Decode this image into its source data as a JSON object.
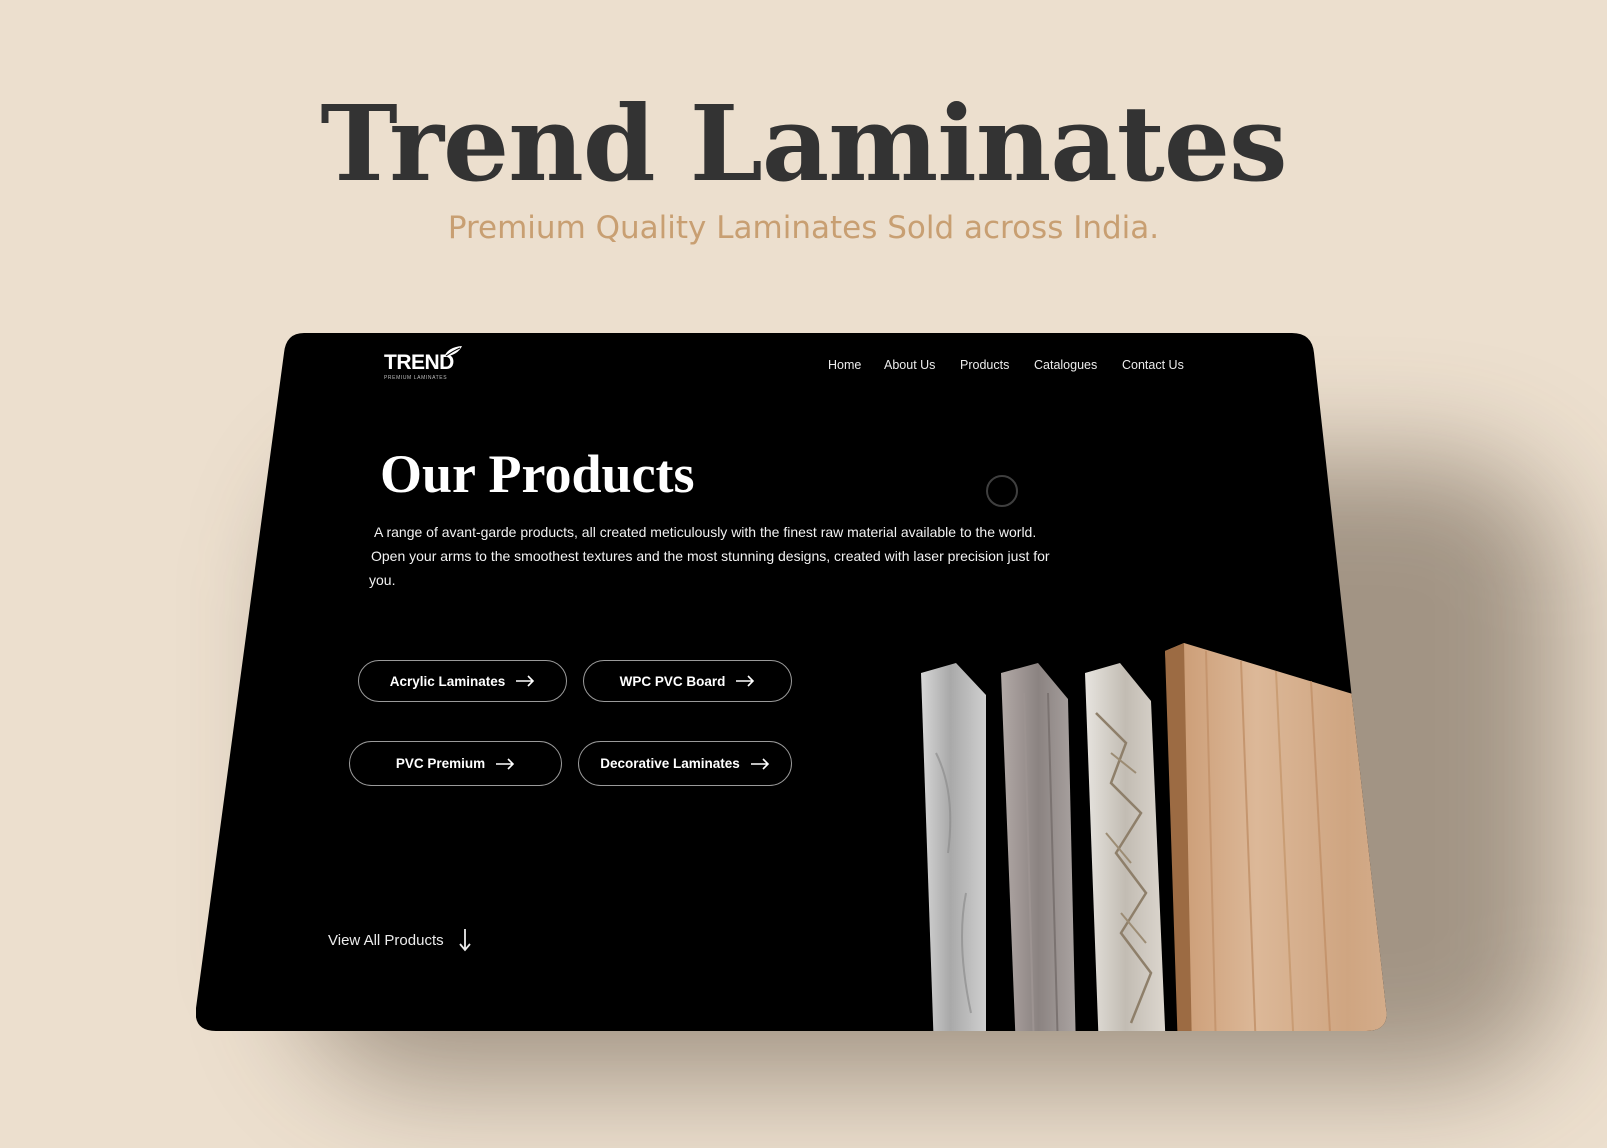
{
  "hero": {
    "title": "Trend Laminates",
    "tagline": "Premium Quality Laminates Sold across India."
  },
  "site": {
    "logo": {
      "word": "TREND",
      "tagline": "PREMIUM LAMINATES",
      "icon": "leaf-icon"
    },
    "nav": [
      "Home",
      "About Us",
      "Products",
      "Catalogues",
      "Contact Us"
    ],
    "page_title": "Our Products",
    "description": [
      "A range of avant-garde products, all created meticulously with the finest raw material available to the world.",
      "Open your arms to the smoothest textures and the most stunning designs, created with laser precision just for",
      "you."
    ],
    "categories": [
      {
        "label": "Acrylic Laminates",
        "icon": "arrow-right-icon"
      },
      {
        "label": "WPC PVC Board",
        "icon": "arrow-right-icon"
      },
      {
        "label": "PVC Premium",
        "icon": "arrow-right-icon"
      },
      {
        "label": "Decorative Laminates",
        "icon": "arrow-right-icon"
      }
    ],
    "view_all": {
      "label": "View All Products",
      "icon": "arrow-down-icon"
    }
  },
  "colors": {
    "page_background": "#ecdfce",
    "title": "#333333",
    "tagline": "#c89f72",
    "screen": "#000000",
    "text_on_dark": "#ffffff",
    "pill_border": "#9a9a9a"
  }
}
